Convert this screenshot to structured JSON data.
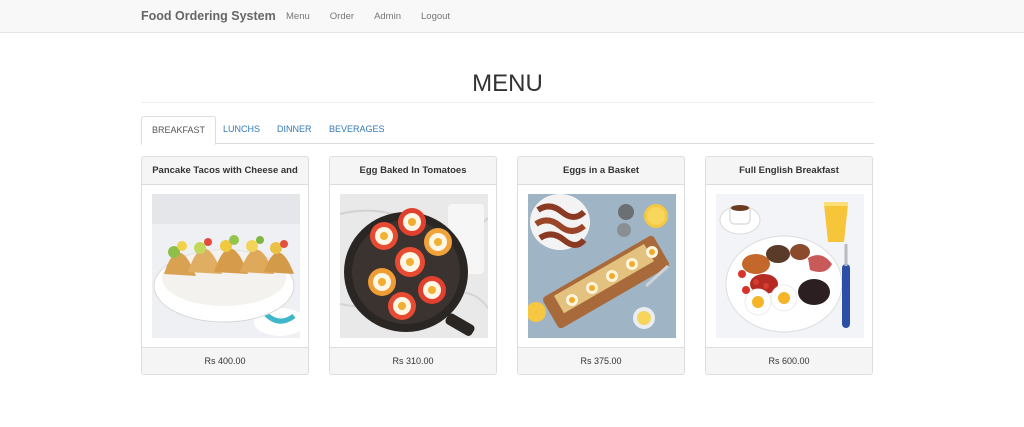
{
  "navbar": {
    "brand": "Food Ordering System",
    "links": [
      "Menu",
      "Order",
      "Admin",
      "Logout"
    ]
  },
  "page": {
    "title": "MENU"
  },
  "tabs": [
    {
      "label": "BREAKFAST",
      "active": true
    },
    {
      "label": "LUNCHS",
      "active": false
    },
    {
      "label": "DINNER",
      "active": false
    },
    {
      "label": "BEVERAGES",
      "active": false
    }
  ],
  "items": [
    {
      "name": "Pancake Tacos with Cheese and",
      "price": "Rs 400.00",
      "image": "pancake-tacos-photo"
    },
    {
      "name": "Egg Baked In Tomatoes",
      "price": "Rs 310.00",
      "image": "egg-baked-tomatoes-photo"
    },
    {
      "name": "Eggs in a Basket",
      "price": "Rs 375.00",
      "image": "eggs-in-basket-photo"
    },
    {
      "name": "Full English Breakfast",
      "price": "Rs 600.00",
      "image": "full-english-breakfast-photo"
    }
  ],
  "colors": {
    "navbar_bg": "#f8f8f8",
    "link": "#337ab7",
    "panel_bg": "#f5f5f5",
    "border": "#dddddd"
  }
}
